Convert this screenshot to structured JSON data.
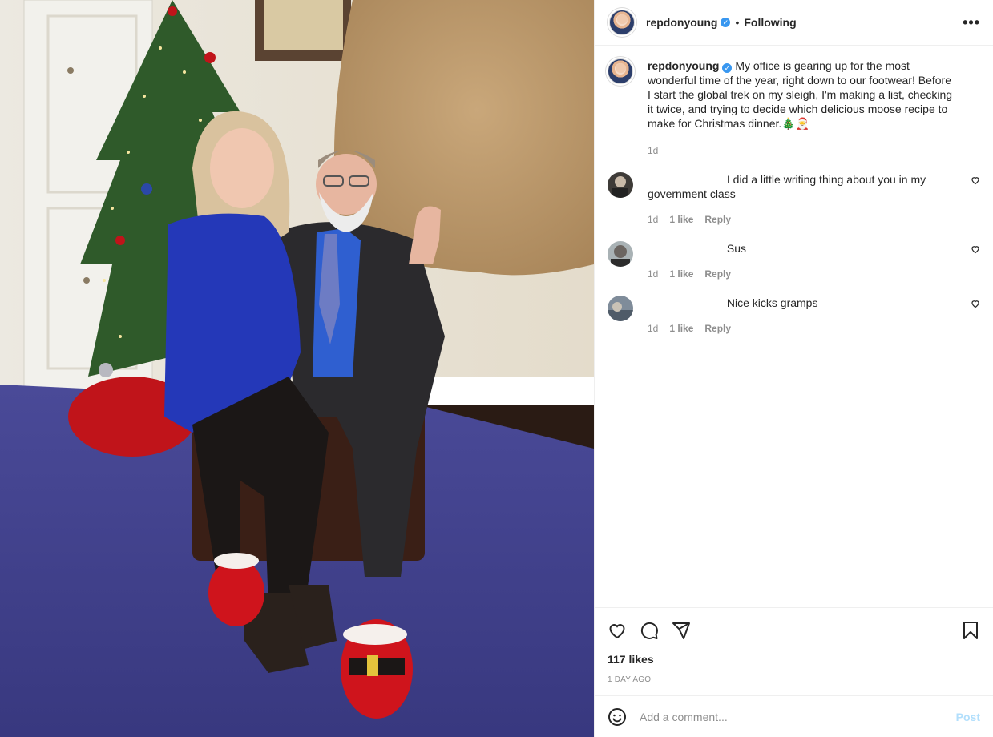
{
  "header": {
    "username": "repdonyoung",
    "separator": "•",
    "follow_status": "Following",
    "more_label": "•••"
  },
  "caption": {
    "username": "repdonyoung",
    "text": "My office is gearing up for the most wonderful time of the year, right down to our footwear! Before I start the global trek on my sleigh, I'm making a list, checking it twice, and trying to decide which delicious moose recipe to make for Christmas dinner.🎄🎅",
    "time": "1d"
  },
  "comments": [
    {
      "username": "",
      "text": "I did a little writing thing about you in my government class",
      "time": "1d",
      "likes": "1 like",
      "reply": "Reply"
    },
    {
      "username": "",
      "text": "Sus",
      "time": "1d",
      "likes": "1 like",
      "reply": "Reply"
    },
    {
      "username": "",
      "text": "Nice kicks gramps",
      "time": "1d",
      "likes": "1 like",
      "reply": "Reply"
    }
  ],
  "actions": {
    "like_icon": "heart-icon",
    "comment_icon": "comment-bubble-icon",
    "share_icon": "paper-plane-icon",
    "save_icon": "bookmark-icon"
  },
  "likes": "117 likes",
  "timestamp": "1 DAY AGO",
  "add_comment": {
    "emoji_icon": "smiley-icon",
    "placeholder": "Add a comment...",
    "post_label": "Post"
  },
  "colors": {
    "verified": "#3897f0",
    "post_button": "#b2dffc",
    "carpet": "#3f3f8f",
    "tree_skirt": "#c0141a"
  }
}
